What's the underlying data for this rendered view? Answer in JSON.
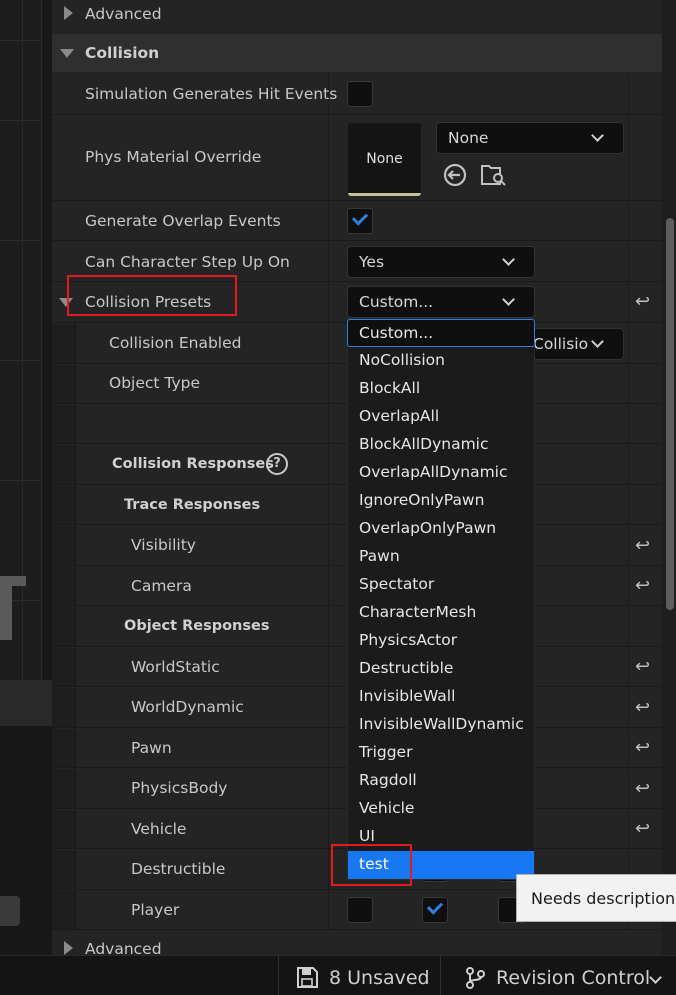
{
  "sections": {
    "advanced_top": "Advanced",
    "collision": "Collision",
    "advanced_bottom": "Advanced"
  },
  "properties": {
    "sim_hit_events": "Simulation Generates Hit Events",
    "phys_material": "Phys Material Override",
    "phys_thumb": "None",
    "phys_combo": "None",
    "overlap_events": "Generate Overlap Events",
    "step_up": "Can Character Step Up On",
    "step_up_value": "Yes",
    "presets": "Collision Presets",
    "presets_value": "Custom...",
    "collision_enabled": "Collision Enabled",
    "collision_enabled_value": "Collisio",
    "object_type": "Object Type"
  },
  "responses": {
    "header": "Collision Responses",
    "help": "?",
    "trace_header": "Trace Responses",
    "visibility": "Visibility",
    "camera": "Camera",
    "object_header": "Object Responses",
    "world_static": "WorldStatic",
    "world_dynamic": "WorldDynamic",
    "pawn": "Pawn",
    "physics_body": "PhysicsBody",
    "vehicle": "Vehicle",
    "destructible": "Destructible",
    "player": "Player"
  },
  "dropdown": {
    "search_value": "Custom...",
    "items": [
      "NoCollision",
      "BlockAll",
      "OverlapAll",
      "BlockAllDynamic",
      "OverlapAllDynamic",
      "IgnoreOnlyPawn",
      "OverlapOnlyPawn",
      "Pawn",
      "Spectator",
      "CharacterMesh",
      "PhysicsActor",
      "Destructible",
      "InvisibleWall",
      "InvisibleWallDynamic",
      "Trigger",
      "Ragdoll",
      "Vehicle",
      "UI",
      "test"
    ],
    "selected": "test"
  },
  "tooltip": "Needs description",
  "statusbar": {
    "unsaved": "8 Unsaved",
    "revision": "Revision Control"
  },
  "colors": {
    "accent": "#1877f2",
    "highlight_box": "#e01b1b",
    "panel_bg": "#242424"
  }
}
